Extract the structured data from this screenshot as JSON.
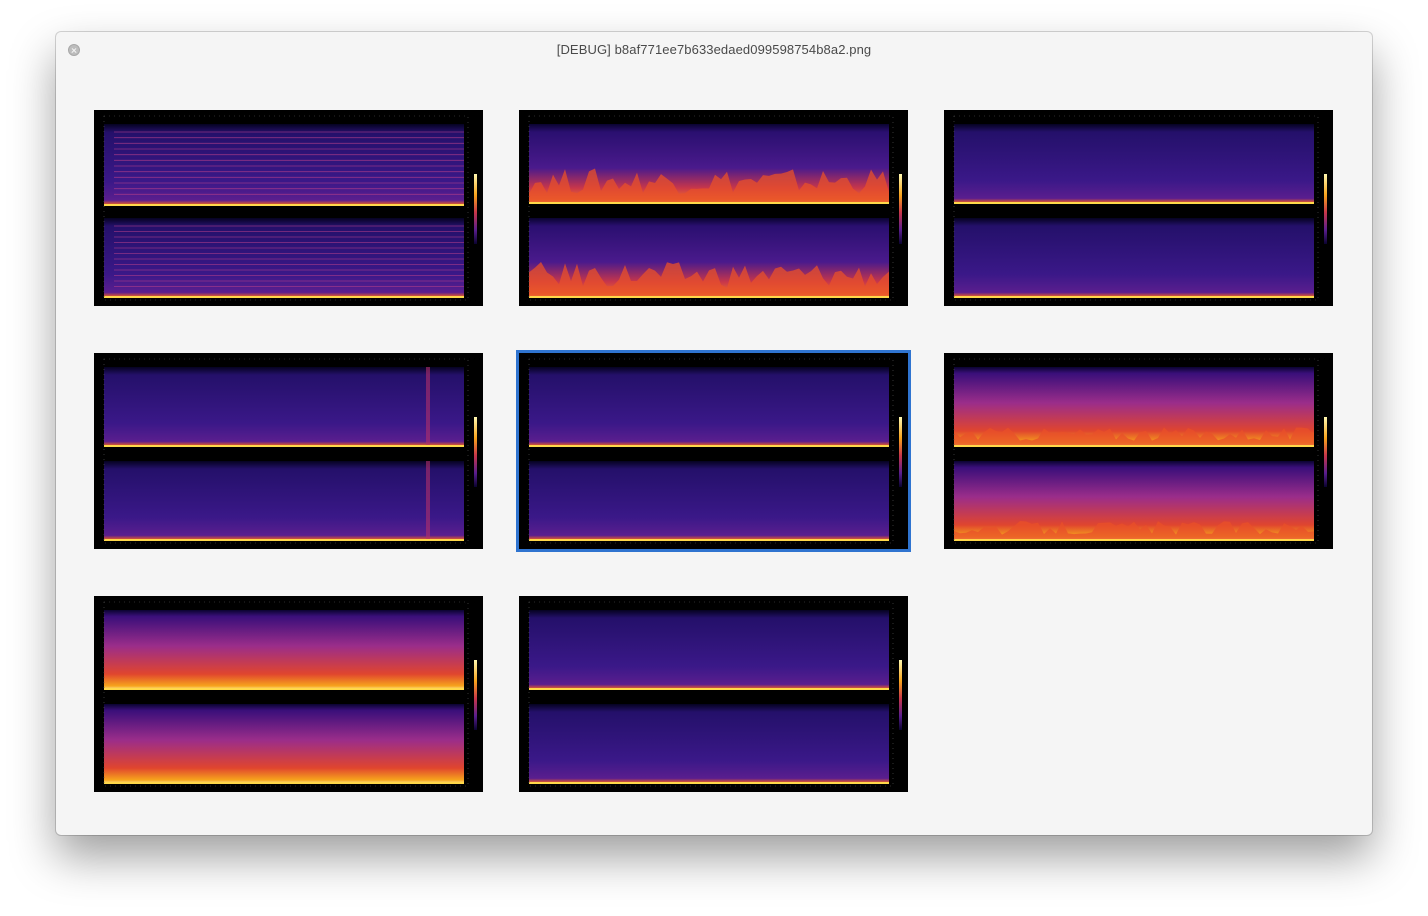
{
  "window": {
    "title": "[DEBUG] b8af771ee7b633edaed099598754b8a2.png"
  },
  "icons": {
    "close": "close-icon"
  },
  "colors": {
    "selection": "#2f74d0",
    "thumbnail_background": "#000000",
    "window_background": "#f5f5f5"
  },
  "thumbnails": [
    {
      "style": "lined",
      "selected": false
    },
    {
      "style": "spiky",
      "selected": false
    },
    {
      "style": "quiet",
      "selected": false
    },
    {
      "style": "burst",
      "selected": false
    },
    {
      "style": "quiet",
      "selected": true
    },
    {
      "style": "bright",
      "selected": false
    },
    {
      "style": "full",
      "selected": false
    },
    {
      "style": "quiet",
      "selected": false
    }
  ]
}
